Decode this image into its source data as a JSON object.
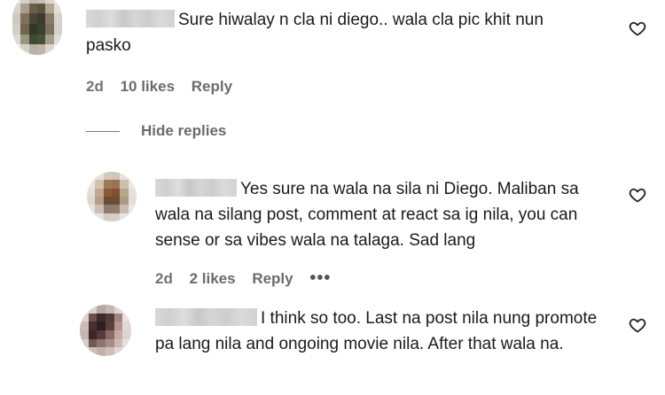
{
  "comments": [
    {
      "text": "Sure hiwalay n cla ni diego.. wala cla pic khit nun pasko",
      "time": "2d",
      "likes": "10 likes",
      "reply": "Reply"
    }
  ],
  "thread": {
    "hide_replies": "Hide replies"
  },
  "replies": [
    {
      "text": "Yes sure na wala na sila ni Diego. Maliban sa wala na silang post, comment at react sa ig nila, you can sense or sa vibes wala na talaga. Sad lang",
      "time": "2d",
      "likes": "2 likes",
      "reply": "Reply",
      "more": "•••"
    },
    {
      "text": "I think so too. Last na post nila nung promote pa lang nila and ongoing movie nila. After that wala na."
    }
  ],
  "icons": {
    "like": "heart-outline-icon",
    "more": "more-options-icon"
  },
  "colors": {
    "text": "#1a1a1a",
    "meta": "#6b6b6b"
  }
}
